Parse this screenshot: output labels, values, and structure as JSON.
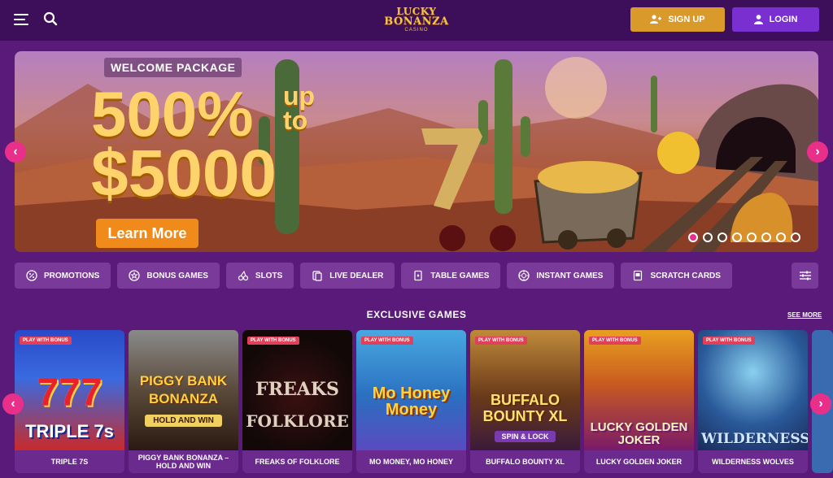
{
  "header": {
    "logo_line1": "LUCKY",
    "logo_line2": "BONANZA",
    "logo_line3": "CASINO",
    "signup_label": "SIGN UP",
    "login_label": "LOGIN"
  },
  "hero": {
    "welcome": "WELCOME PACKAGE",
    "percent": "500%",
    "upto_line1": "up",
    "upto_line2": "to",
    "amount": "$5000",
    "cta": "Learn More",
    "slides_total": 8,
    "slide_active": 1
  },
  "categories": [
    {
      "label": "PROMOTIONS",
      "icon": "percent-badge-icon"
    },
    {
      "label": "BONUS GAMES",
      "icon": "star-circle-icon"
    },
    {
      "label": "SLOTS",
      "icon": "cherries-icon"
    },
    {
      "label": "LIVE DEALER",
      "icon": "dealer-cards-icon"
    },
    {
      "label": "TABLE GAMES",
      "icon": "playing-card-icon"
    },
    {
      "label": "INSTANT GAMES",
      "icon": "chip-icon"
    },
    {
      "label": "SCRATCH CARDS",
      "icon": "scratch-card-icon"
    }
  ],
  "section": {
    "title": "EXCLUSIVE GAMES",
    "see_more": "SEE MORE"
  },
  "games": [
    {
      "name": "TRIPLE 7S",
      "badge": "PLAY WITH BONUS",
      "art_text": "TRIPLE 7s"
    },
    {
      "name": "PIGGY BANK BONANZA – HOLD AND WIN",
      "badge": "",
      "art_text": "PIGGY BANK BONANZA",
      "art_sub": "HOLD AND WIN"
    },
    {
      "name": "FREAKS OF FOLKLORE",
      "badge": "PLAY WITH BONUS",
      "art_text": "FREAKS",
      "art_sub": "FOLKLORE"
    },
    {
      "name": "MO MONEY, MO HONEY",
      "badge": "PLAY WITH BONUS",
      "art_text": "Mo Honey Money"
    },
    {
      "name": "BUFFALO BOUNTY XL",
      "badge": "PLAY WITH BONUS",
      "art_text": "BUFFALO BOUNTY XL",
      "art_sub": "SPIN & LOCK"
    },
    {
      "name": "LUCKY GOLDEN JOKER",
      "badge": "PLAY WITH BONUS",
      "art_text": "LUCKY GOLDEN JOKER"
    },
    {
      "name": "WILDERNESS WOLVES",
      "badge": "PLAY WITH BONUS",
      "art_text": "WILDERNESS"
    }
  ]
}
